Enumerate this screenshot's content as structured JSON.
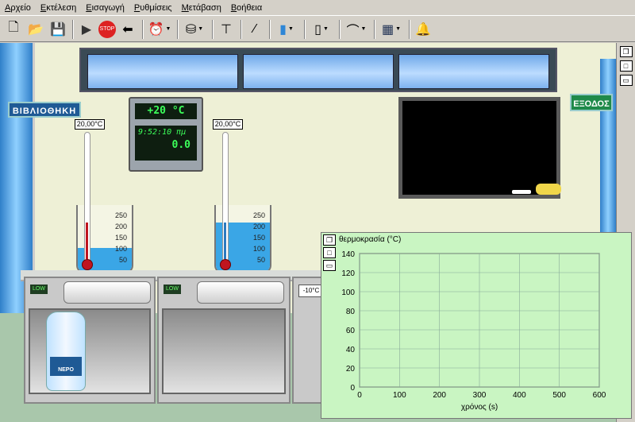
{
  "menu": [
    "Αρχείο",
    "Εκτέλεση",
    "Εισαγωγή",
    "Ρυθμίσεις",
    "Μετάβαση",
    "Βοήθεια"
  ],
  "toolbar": {
    "new": "🗋",
    "open": "📂",
    "save": "💾",
    "play": "▶",
    "stop": "STOP",
    "back": "⬅",
    "timer": "⏰",
    "beaker": "⛁",
    "stand": "⊤",
    "rod": "⁄",
    "bottle": "▮",
    "can": "▯",
    "plate": "⌒",
    "fig": "▦",
    "bell": "🔔"
  },
  "signs": {
    "library": "ΒΙΒΛΙΟΘΗΚΗ",
    "exit": "ΕΞΟΔΟΣ"
  },
  "display": {
    "temperature": "+20 °C",
    "clock": "9:52:10 πμ",
    "value": "0.0"
  },
  "thermometers": [
    "20,00°C",
    "20,00°C"
  ],
  "beaker_scale": [
    "250",
    "200",
    "150",
    "100",
    "50"
  ],
  "heater": {
    "low_label": "LOW",
    "external_temp": "-10°C"
  },
  "bottle_label": "ΝΕΡΟ",
  "chart_data": {
    "type": "line",
    "ylabel": "θερμοκρασία (°C)",
    "xlabel": "χρόνος (s)",
    "xlim": [
      0,
      600
    ],
    "ylim": [
      0,
      140
    ],
    "x_ticks": [
      0,
      100,
      200,
      300,
      400,
      500,
      600
    ],
    "y_ticks": [
      0,
      20,
      40,
      60,
      80,
      100,
      120,
      140
    ],
    "grid": true,
    "series": []
  }
}
